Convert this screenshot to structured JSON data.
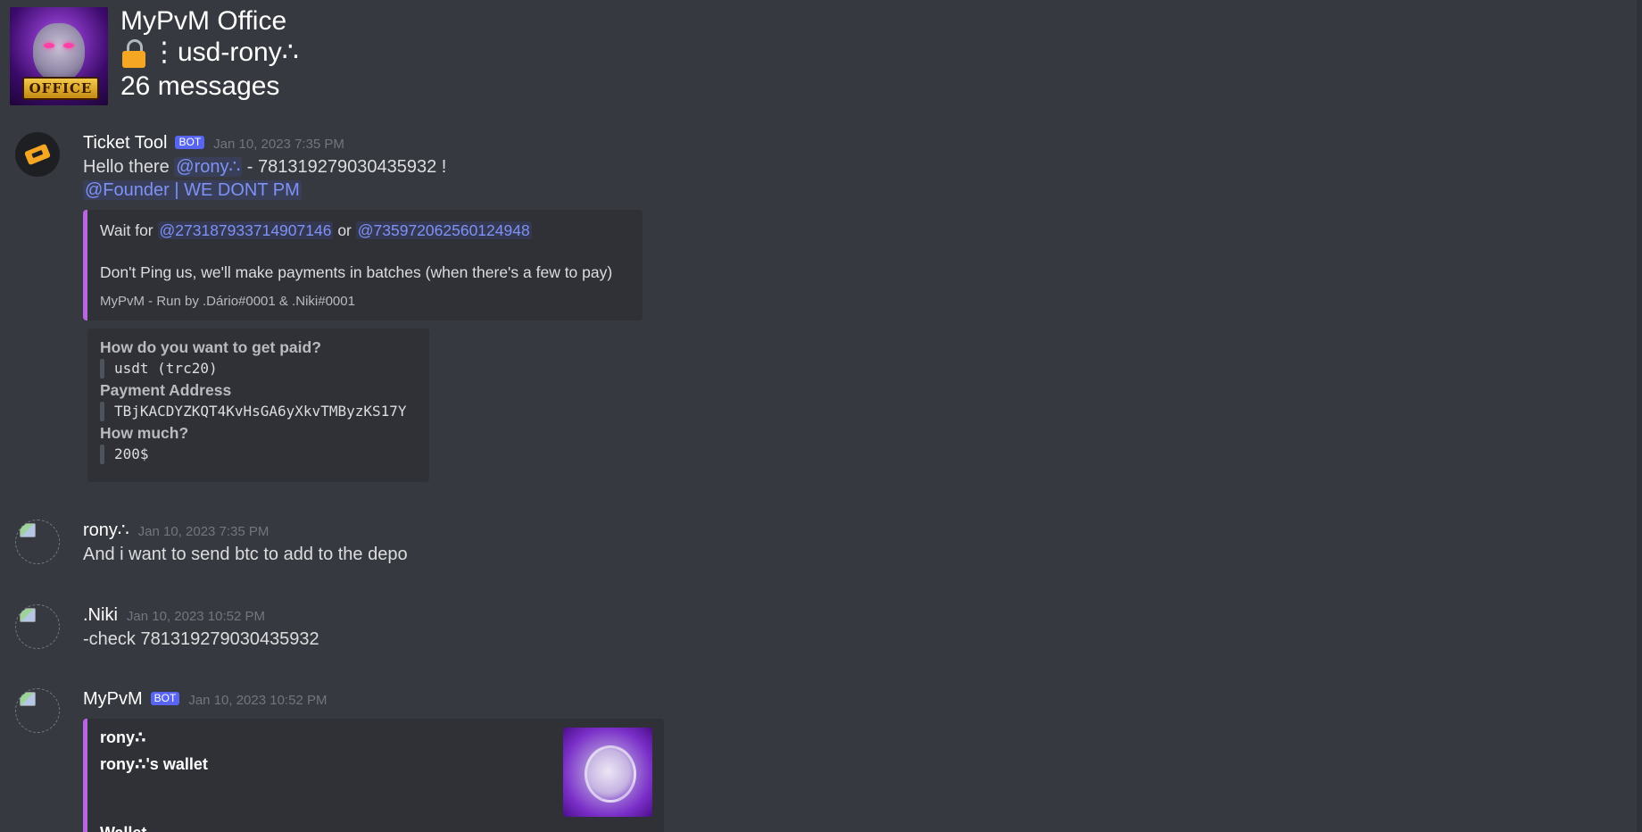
{
  "guild": {
    "name": "MyPvM Office",
    "icon": "guild-icon",
    "icon_banner_text": "OFFICE"
  },
  "channel": {
    "lock_icon": "lock-icon",
    "name": "⋮usd-rony∴"
  },
  "message_count": "26 messages",
  "colors": {
    "background": "#36393f",
    "embed_background": "#2f3136",
    "embed_accent": "#b964e0",
    "bot_tag": "#5865f2",
    "mention": "#7e92f5",
    "timestamp": "#72767d"
  },
  "messages": [
    {
      "author": "Ticket Tool",
      "bot_tag": "BOT",
      "avatar_icon": "ticket-icon",
      "timestamp": "Jan 10, 2023 7:35 PM",
      "text_pre": "Hello there ",
      "mention_user": "@rony∴",
      "text_post": " - 781319279030435932 !",
      "role_mention": "@Founder | WE DONT PM",
      "embed": {
        "wait_pre": "Wait for ",
        "mention_1": "@273187933714907146",
        "wait_mid": " or ",
        "mention_2": "@735972062560124948",
        "description": "Don't Ping us, we'll make payments in batches (when there's a few to pay)",
        "footer": "MyPvM - Run by .Dário#0001 & .Niki#0001"
      },
      "fields_embed": {
        "fields": [
          {
            "name": "How do you want to get paid?",
            "value": "usdt  (trc20)"
          },
          {
            "name": "Payment Address",
            "value": "TBjKACDYZKQT4KvHsGA6yXkvTMByzKS17Y"
          },
          {
            "name": "How much?",
            "value": "200$"
          }
        ]
      }
    },
    {
      "author": "rony∴",
      "avatar_icon": "broken-image-icon",
      "timestamp": "Jan 10, 2023 7:35 PM",
      "text": "And i want to send btc to add to the depo"
    },
    {
      "author": ".Niki",
      "avatar_icon": "broken-image-icon",
      "timestamp": "Jan 10, 2023 10:52 PM",
      "text": "-check 781319279030435932"
    },
    {
      "author": "MyPvM",
      "bot_tag": "BOT",
      "avatar_icon": "broken-image-icon",
      "timestamp": "Jan 10, 2023 10:52 PM",
      "embed": {
        "author_line": "rony∴",
        "title": "rony∴'s wallet",
        "partial_field": "Wallet",
        "thumbnail_icon": "wallet-thumbnail-image"
      }
    }
  ]
}
